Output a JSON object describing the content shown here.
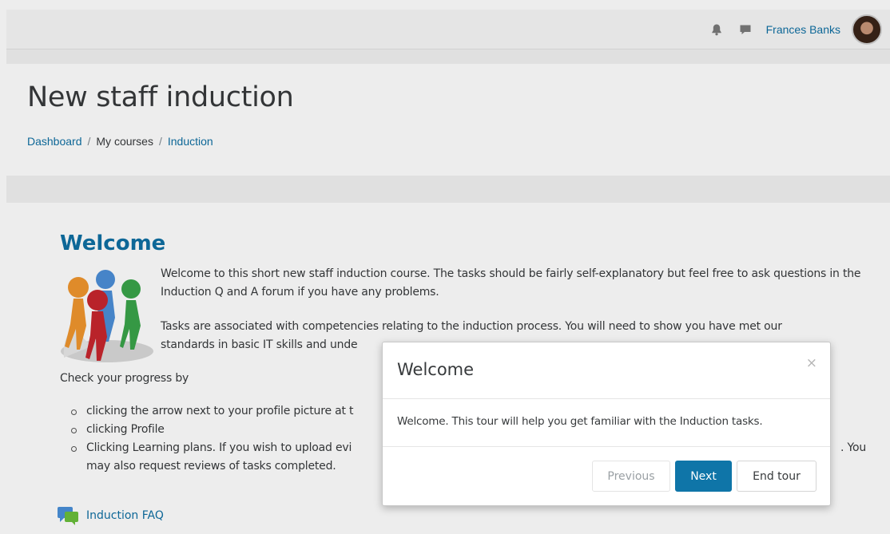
{
  "navbar": {
    "notifications_icon": "bell-icon",
    "messages_icon": "speech-bubble-icon",
    "user_name": "Frances Banks"
  },
  "header": {
    "title": "New staff induction",
    "breadcrumb": [
      "Dashboard",
      "My courses",
      "Induction"
    ]
  },
  "content": {
    "section_title": "Welcome",
    "paragraph1": "Welcome to this short new staff induction course. The tasks should be fairly self-explanatory but feel free to ask questions in the Induction Q and A forum if you have any problems.",
    "paragraph2_line1": "Tasks are associated with competencies relating to the induction process. You will need to show you have met our",
    "paragraph2_line2": "standards in basic IT skills and unde",
    "check_label": "Check your progress by",
    "steps": [
      "clicking the arrow next to your profile picture at t",
      "clicking Profile",
      "Clicking Learning plans. If you wish to upload evi"
    ],
    "steps_tail": ". You",
    "steps_continuation": "may also request reviews of tasks completed.",
    "faq_label": "Induction FAQ"
  },
  "modal": {
    "title": "Welcome",
    "close_glyph": "×",
    "body": "Welcome. This tour will help you get familiar with the Induction tasks.",
    "buttons": {
      "previous": "Previous",
      "next": "Next",
      "end": "End tour"
    }
  },
  "colors": {
    "link": "#0f6fa3",
    "primary_button": "#0f75a8"
  }
}
